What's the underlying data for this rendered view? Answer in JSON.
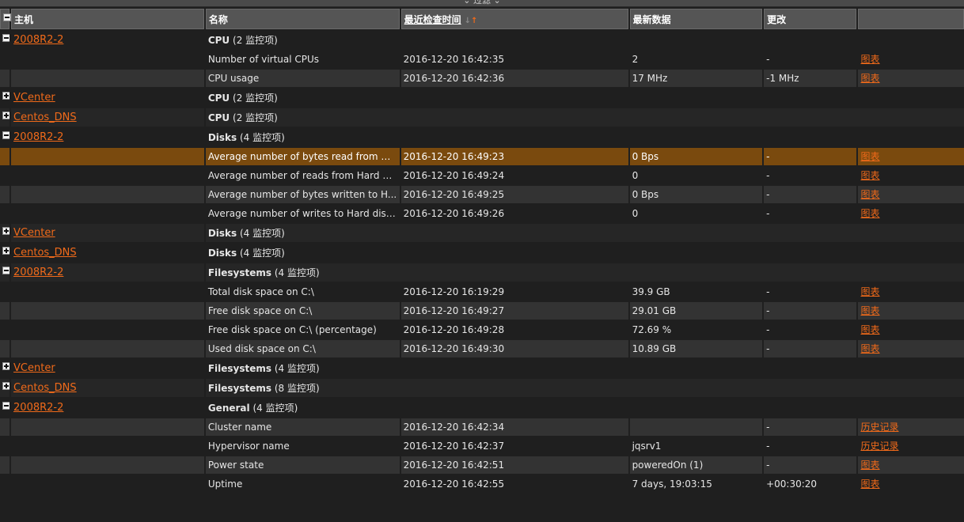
{
  "filter_label": "过滤",
  "columns": {
    "host": "主机",
    "name": "名称",
    "lastcheck": "最近检查时间",
    "lastvalue": "最新数据",
    "change": "更改"
  },
  "groups": [
    {
      "host": "2008R2-2",
      "expanded": true,
      "app": "CPU",
      "count": "(2 监控项)"
    },
    {
      "host": "VCenter",
      "expanded": false,
      "app": "CPU",
      "count": "(2 监控项)"
    },
    {
      "host": "Centos_DNS",
      "expanded": false,
      "app": "CPU",
      "count": "(2 监控项)"
    },
    {
      "host": "2008R2-2",
      "expanded": true,
      "app": "Disks",
      "count": "(4 监控项)"
    },
    {
      "host": "VCenter",
      "expanded": false,
      "app": "Disks",
      "count": "(4 监控项)"
    },
    {
      "host": "Centos_DNS",
      "expanded": false,
      "app": "Disks",
      "count": "(4 监控项)"
    },
    {
      "host": "2008R2-2",
      "expanded": true,
      "app": "Filesystems",
      "count": "(4 监控项)"
    },
    {
      "host": "VCenter",
      "expanded": false,
      "app": "Filesystems",
      "count": "(4 监控项)"
    },
    {
      "host": "Centos_DNS",
      "expanded": false,
      "app": "Filesystems",
      "count": "(8 监控项)"
    },
    {
      "host": "2008R2-2",
      "expanded": true,
      "app": "General",
      "count": "(4 监控项)"
    }
  ],
  "items": {
    "cpu": [
      {
        "name": "Number of virtual CPUs",
        "time": "2016-12-20 16:42:35",
        "value": "2",
        "change": "-",
        "action": "图表"
      },
      {
        "name": "CPU usage",
        "time": "2016-12-20 16:42:36",
        "value": "17 MHz",
        "change": "-1 MHz",
        "action": "图表"
      }
    ],
    "disks": [
      {
        "name": "Average number of bytes read from H...",
        "time": "2016-12-20 16:49:23",
        "value": "0 Bps",
        "change": "-",
        "action": "图表"
      },
      {
        "name": "Average number of reads from Hard di...",
        "time": "2016-12-20 16:49:24",
        "value": "0",
        "change": "-",
        "action": "图表"
      },
      {
        "name": "Average number of bytes written to H...",
        "time": "2016-12-20 16:49:25",
        "value": "0 Bps",
        "change": "-",
        "action": "图表"
      },
      {
        "name": "Average number of writes to Hard disk...",
        "time": "2016-12-20 16:49:26",
        "value": "0",
        "change": "-",
        "action": "图表"
      }
    ],
    "filesystems": [
      {
        "name": "Total disk space on C:\\",
        "time": "2016-12-20 16:19:29",
        "value": "39.9 GB",
        "change": "-",
        "action": "图表"
      },
      {
        "name": "Free disk space on C:\\",
        "time": "2016-12-20 16:49:27",
        "value": "29.01 GB",
        "change": "-",
        "action": "图表"
      },
      {
        "name": "Free disk space on C:\\ (percentage)",
        "time": "2016-12-20 16:49:28",
        "value": "72.69 %",
        "change": "-",
        "action": "图表"
      },
      {
        "name": "Used disk space on C:\\",
        "time": "2016-12-20 16:49:30",
        "value": "10.89 GB",
        "change": "-",
        "action": "图表"
      }
    ],
    "general": [
      {
        "name": "Cluster name",
        "time": "2016-12-20 16:42:34",
        "value": "",
        "change": "-",
        "action": "历史记录"
      },
      {
        "name": "Hypervisor name",
        "time": "2016-12-20 16:42:37",
        "value": "jqsrv1",
        "change": "-",
        "action": "历史记录"
      },
      {
        "name": "Power state",
        "time": "2016-12-20 16:42:51",
        "value": "poweredOn (1)",
        "change": "-",
        "action": "图表"
      },
      {
        "name": "Uptime",
        "time": "2016-12-20 16:42:55",
        "value": "7 days, 19:03:15",
        "change": "+00:30:20",
        "action": "图表"
      }
    ]
  },
  "colors": {
    "accent": "#f06a1a",
    "highlight_row": "#7a4a0e",
    "header_bg": "#555555",
    "page_bg": "#1f1f1f"
  }
}
